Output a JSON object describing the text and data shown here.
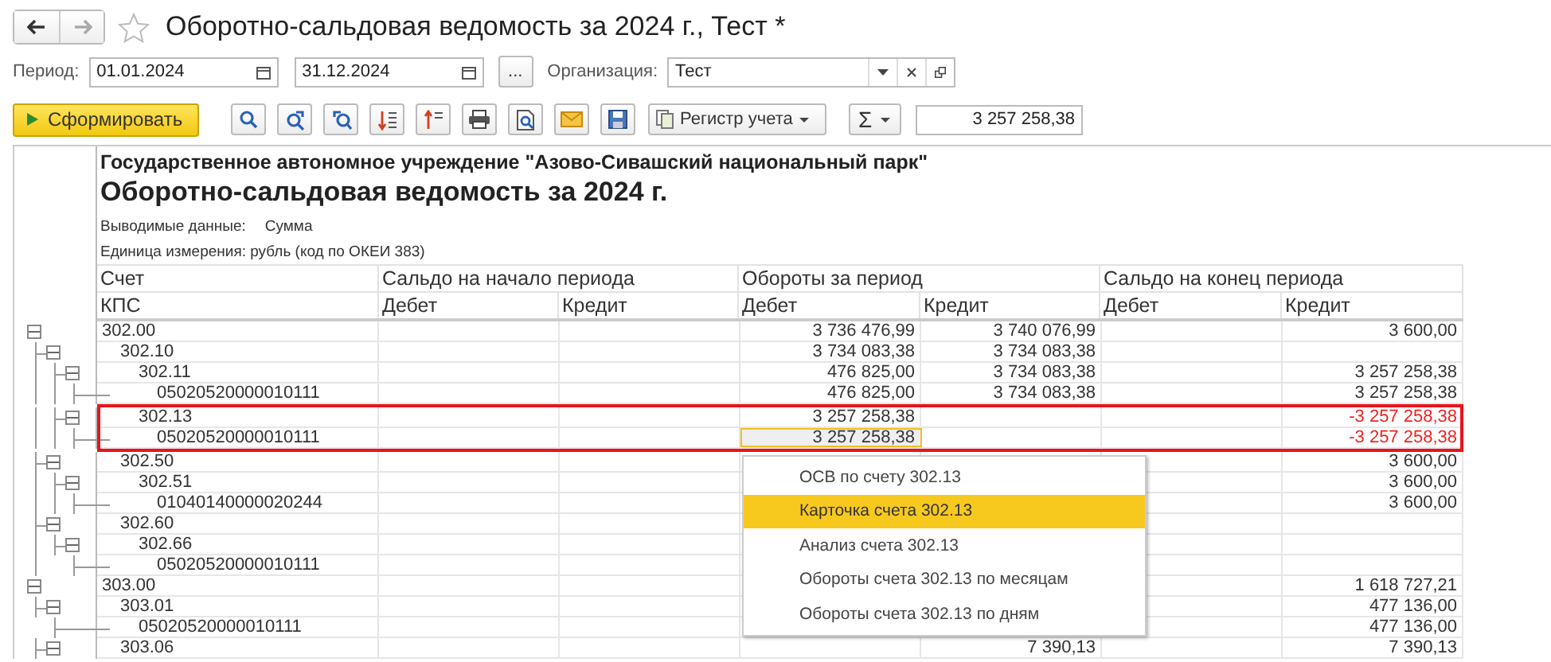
{
  "window": {
    "title": "Оборотно-сальдовая ведомость за 2024 г., Тест *",
    "favorite": false
  },
  "filters": {
    "period_label": "Период:",
    "date_from": "01.01.2024",
    "date_to": "31.12.2024",
    "more_button": "...",
    "organization_label": "Организация:",
    "organization": "Тест"
  },
  "toolbar": {
    "generate_button": "Сформировать",
    "register_button": "Регистр учета",
    "sum_button": "Σ",
    "sum_value": "3 257 258,38"
  },
  "report": {
    "organization": "Государственное автономное учреждение \"Азово-Сивашский национальный парк\"",
    "title": "Оборотно-сальдовая ведомость за 2024 г.",
    "output_label": "Выводимые данные:",
    "output_value": "Сумма",
    "unit": "Единица измерения: рубль (код по ОКЕИ 383)",
    "header": {
      "account": "Счет",
      "kps": "КПС",
      "opening": "Сальдо на начало периода",
      "turnover": "Обороты за период",
      "closing": "Сальдо на конец периода",
      "opening_debit": "Дебет",
      "opening_credit": "Кредит",
      "turnover_debit": "Дебет",
      "turnover_credit": "Кредит",
      "closing_debit": "Дебет",
      "closing_credit": "Кредит"
    },
    "rows": [
      {
        "account": "302.00",
        "expanded": true,
        "values": {
          "turnover_debit": "3 736 476,99",
          "turnover_credit": "3 740 076,99",
          "closing_credit": "3 600,00"
        },
        "children": [
          {
            "account": "302.10",
            "expanded": true,
            "values": {
              "turnover_debit": "3 734 083,38",
              "turnover_credit": "3 734 083,38"
            },
            "children": [
              {
                "account": "302.11",
                "expanded": true,
                "values": {
                  "turnover_debit": "476 825,00",
                  "turnover_credit": "3 734 083,38",
                  "closing_credit": "3 257 258,38"
                },
                "children": [
                  {
                    "account": "05020520000010111",
                    "values": {
                      "turnover_debit": "476 825,00",
                      "turnover_credit": "3 734 083,38",
                      "closing_credit": "3 257 258,38"
                    }
                  }
                ]
              },
              {
                "account": "302.13",
                "expanded": true,
                "outlined": true,
                "negative": true,
                "values": {
                  "turnover_debit": "3 257 258,38",
                  "closing_credit": "-3 257 258,38"
                },
                "children": [
                  {
                    "account": "05020520000010111",
                    "negative": true,
                    "values": {
                      "turnover_debit": {
                        "text": "3 257 258,38",
                        "selected": true
                      },
                      "closing_credit": "-3 257 258,38"
                    }
                  }
                ]
              }
            ]
          },
          {
            "account": "302.50",
            "expanded": true,
            "values": {
              "closing_credit": "3 600,00"
            },
            "children": [
              {
                "account": "302.51",
                "expanded": true,
                "values": {
                  "closing_credit": "3 600,00"
                },
                "children": [
                  {
                    "account": "01040140000020244",
                    "values": {
                      "closing_credit": "3 600,00"
                    }
                  }
                ]
              }
            ]
          },
          {
            "account": "302.60",
            "expanded": true,
            "children": [
              {
                "account": "302.66",
                "expanded": true,
                "children": [
                  {
                    "account": "05020520000010111"
                  }
                ]
              }
            ]
          }
        ]
      },
      {
        "account": "303.00",
        "expanded": true,
        "values": {
          "closing_credit": "1 618 727,21"
        },
        "children": [
          {
            "account": "303.01",
            "expanded": true,
            "values": {
              "closing_credit": "477 136,00"
            },
            "children": [
              {
                "account": "05020520000010111",
                "values": {
                  "closing_credit": "477 136,00"
                }
              }
            ]
          },
          {
            "account": "303.06",
            "expanded": true,
            "values": {
              "turnover_credit": "7 390,13",
              "closing_credit": "7 390,13"
            }
          }
        ]
      }
    ]
  },
  "context_menu": [
    {
      "label": "ОСВ по счету 302.13",
      "selected": false
    },
    {
      "label": "Карточка счета 302.13",
      "selected": true
    },
    {
      "label": "Анализ счета 302.13",
      "selected": false
    },
    {
      "label": "Обороты счета 302.13 по месяцам",
      "selected": false
    },
    {
      "label": "Обороты счета 302.13 по дням",
      "selected": false
    }
  ]
}
